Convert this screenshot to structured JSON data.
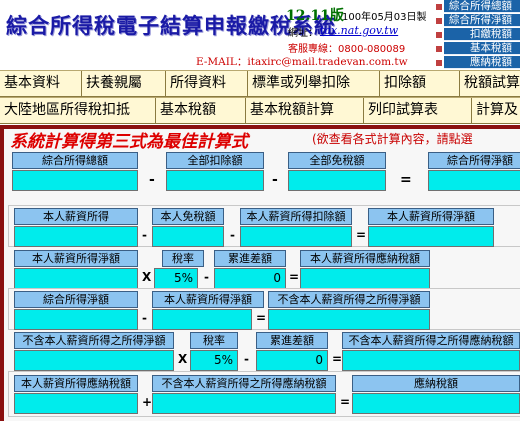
{
  "header": {
    "title": "綜合所得稅電子結算申報繳稅系統",
    "version": "12.11版",
    "release_date": "100年05月03日製",
    "site_label": "網址：",
    "site_url": "tax.nat.gov.tw",
    "support": "客服專線：0800-080089",
    "email": "E-MAIL：itaxirc@mail.tradevan.com.tw"
  },
  "side_menu": [
    "綜合所得總額",
    "綜合所得淨額",
    "扣繳稅額",
    "基本稅額",
    "應納稅額"
  ],
  "nav_row1": [
    "基本資料",
    "扶養親屬",
    "所得資料",
    "標準或列舉扣除",
    "扣除額",
    "稅額試算"
  ],
  "nav_row2": [
    "大陸地區所得稅扣抵",
    "基本稅額",
    "基本稅額計算",
    "列印試算表",
    "計算及"
  ],
  "calc": {
    "title": "系統計算得第三式為最佳計算式",
    "hint": "(欲查看各式計算內容，請點選",
    "row1": {
      "labels": [
        "綜合所得總額",
        "全部扣除額",
        "全部免稅額",
        "綜合所得淨額"
      ],
      "values": [
        "",
        "",
        "",
        ""
      ],
      "ops": [
        "-",
        "-",
        "="
      ]
    },
    "row2": {
      "labels": [
        "本人薪資所得",
        "本人免稅額",
        "本人薪資所得扣除額",
        "本人薪資所得淨額"
      ],
      "values": [
        "",
        "",
        "",
        ""
      ],
      "ops": [
        "-",
        "-",
        "="
      ]
    },
    "row3": {
      "labels": [
        "本人薪資所得淨額",
        "稅率",
        "累進差額",
        "本人薪資所得應納稅額"
      ],
      "values": [
        "",
        "5%",
        "0",
        ""
      ],
      "ops": [
        "X",
        "-",
        "="
      ]
    },
    "row4": {
      "labels": [
        "綜合所得淨額",
        "本人薪資所得淨額",
        "不含本人薪資所得之所得淨額"
      ],
      "values": [
        "",
        "",
        ""
      ],
      "ops": [
        "-",
        "="
      ]
    },
    "row5": {
      "labels": [
        "不含本人薪資所得之所得淨額",
        "稅率",
        "累進差額",
        "不含本人薪資所得之所得應納稅額"
      ],
      "values": [
        "",
        "5%",
        "0",
        ""
      ],
      "ops": [
        "X",
        "-",
        "="
      ]
    },
    "row6": {
      "labels": [
        "本人薪資所得應納稅額",
        "不含本人薪資所得之所得應納稅額",
        "應納稅額"
      ],
      "values": [
        "",
        "",
        ""
      ],
      "ops": [
        "+",
        "="
      ]
    }
  },
  "colors": {
    "title_blue": "#1a1aa6",
    "nav_bg": "#fff8d4",
    "field_cyan": "#00ecec",
    "label_blue": "#8cc4f0",
    "accent_red": "#dd0000",
    "side_menu_blue": "#1b63a8"
  }
}
